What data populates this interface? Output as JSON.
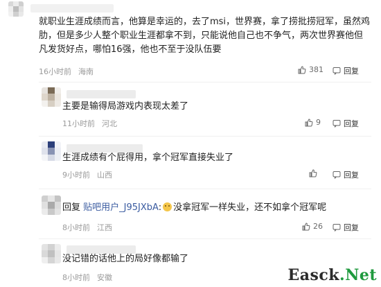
{
  "comments": [
    {
      "text": "就职业生涯成绩而言，他算是幸运的，去了msi，世界赛，拿了捞批捞冠军，虽然鸡肋，但是多少人整个职业生涯都拿不到，只能说他自己也不争气，两次世界赛他但凡发货好点，哪怕16强，他也不至于没队伍要",
      "time": "16小时前",
      "location": "海南",
      "likes": "381",
      "reply": "回复"
    },
    {
      "text": "主要是输得局游戏内表现太差了",
      "time": "11小时前",
      "location": "河北",
      "likes": "9",
      "reply": "回复"
    },
    {
      "text": "生涯成绩有个屁得用，拿个冠军直接失业了",
      "time": "9小时前",
      "location": "山西",
      "likes": "",
      "reply": "回复"
    },
    {
      "reply_prefix": "回复",
      "reply_user": "贴吧用户_J95JXbA",
      "reply_colon": ":",
      "text": "没拿冠军一样失业，还不如拿个冠军呢",
      "time": "8小时前",
      "location": "江西",
      "likes": "26",
      "reply": "回复"
    },
    {
      "text": "没记错的话他上的局好像都输了",
      "time": "8小时前",
      "location": "安徽",
      "likes": "",
      "reply": ""
    }
  ],
  "watermark": {
    "main": "Easck",
    "dot": ".",
    "suffix": "Net"
  }
}
